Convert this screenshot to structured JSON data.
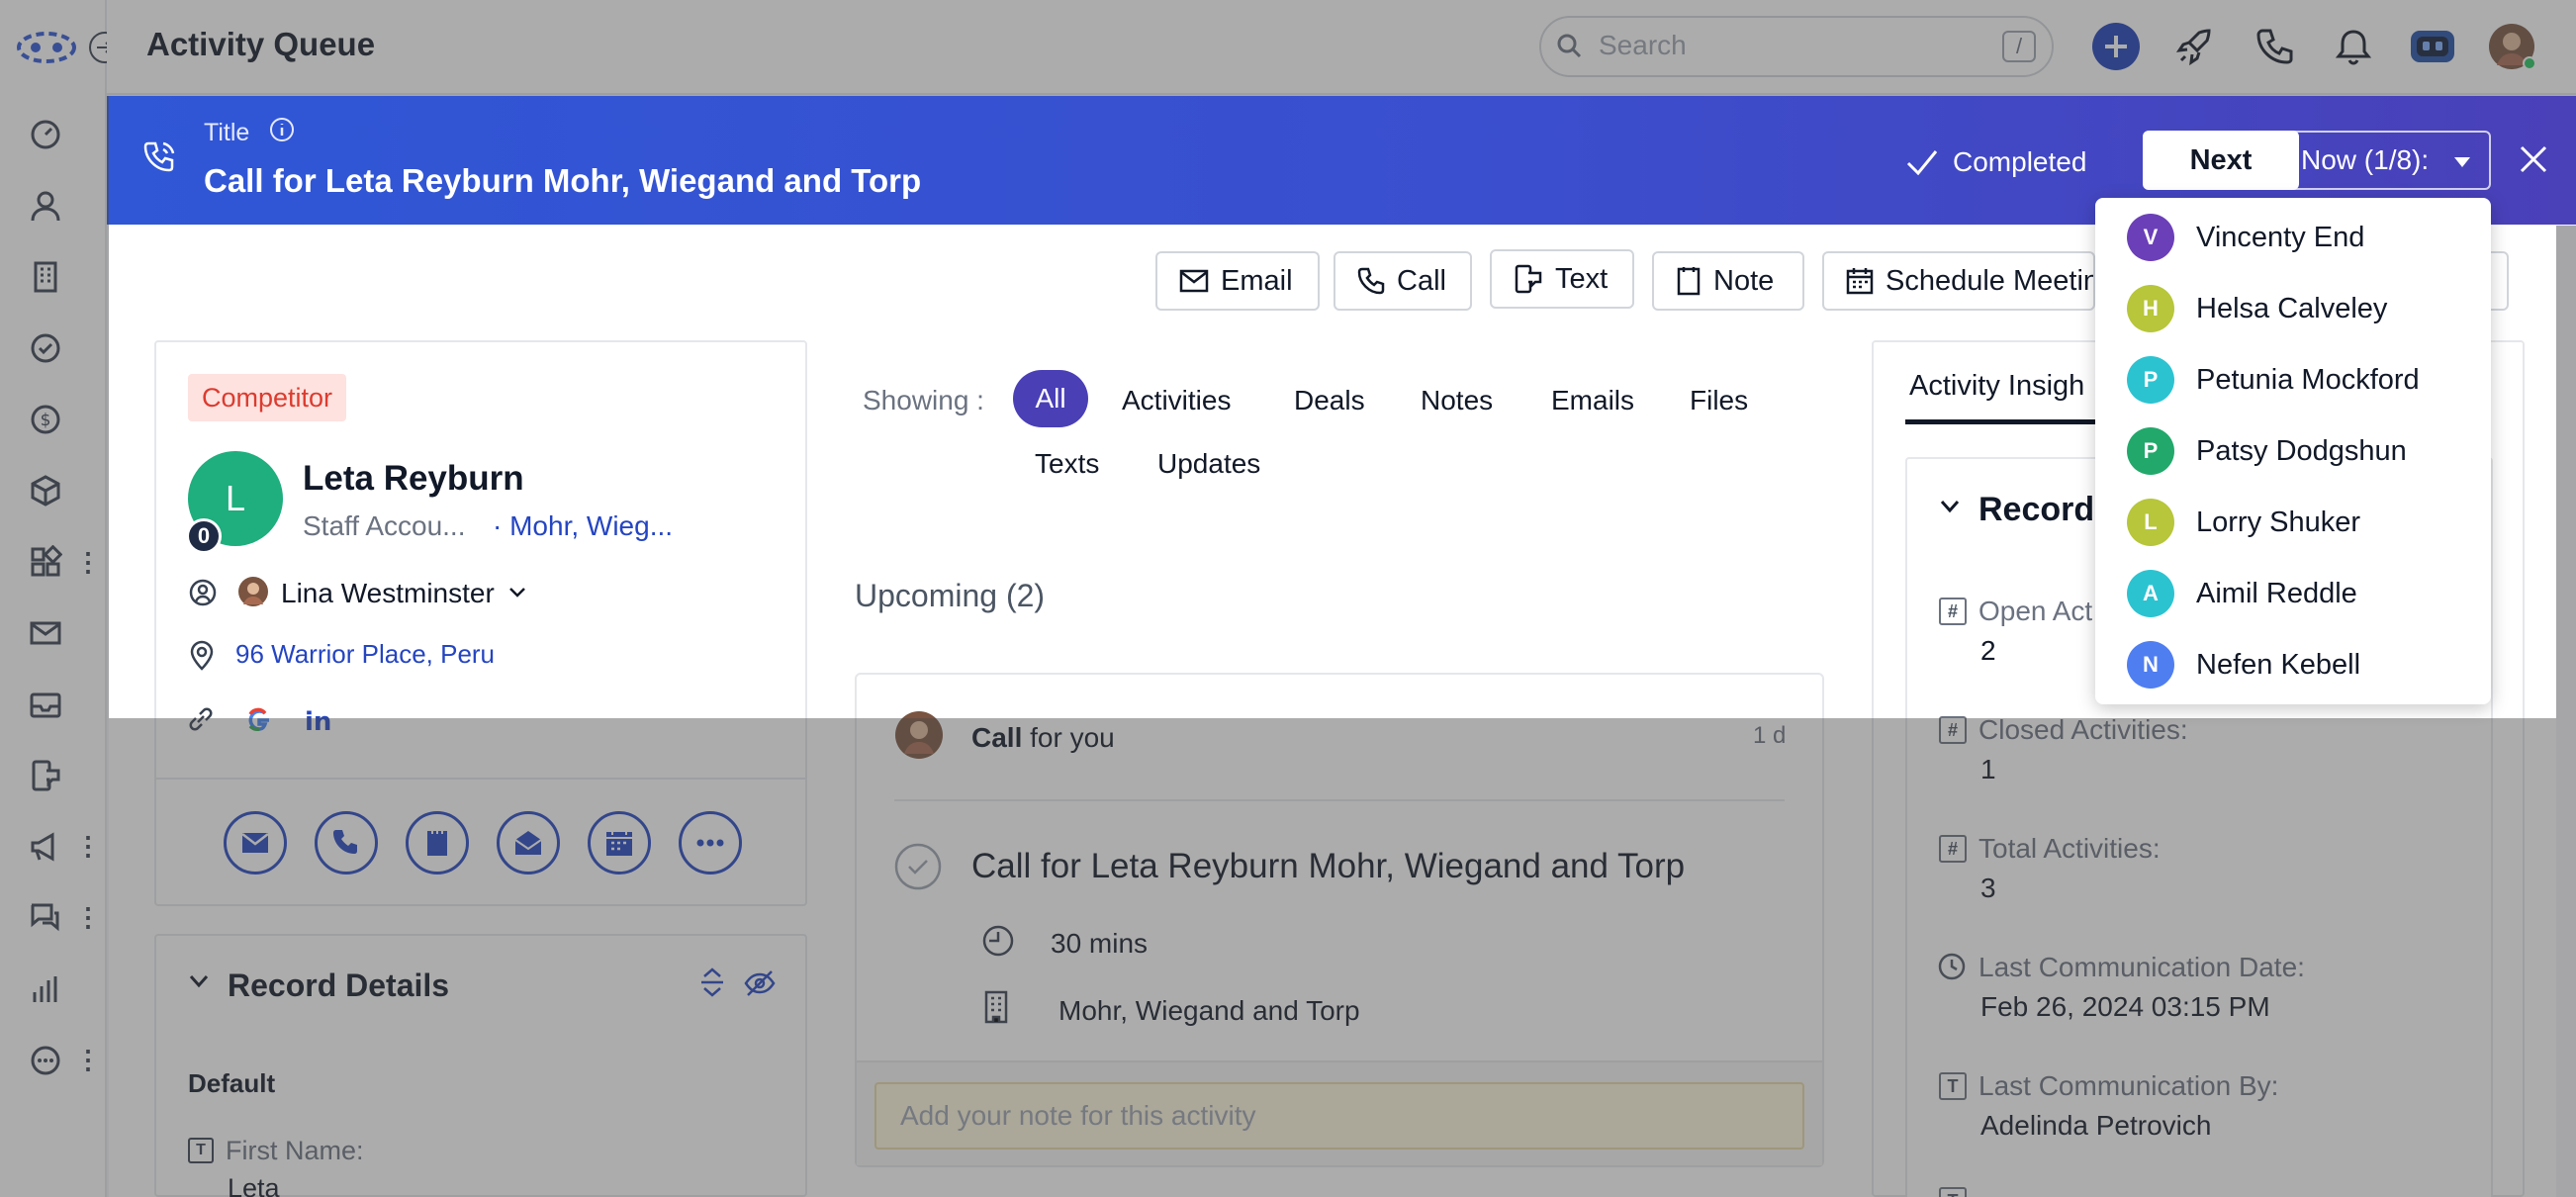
{
  "app": {
    "title": "Activity Queue"
  },
  "search": {
    "placeholder": "Search",
    "shortcut": "/"
  },
  "header": {
    "title_label": "Title",
    "title": "Call for Leta Reyburn Mohr, Wiegand and Torp",
    "completed_label": "Completed",
    "next_label": "Next",
    "now_label": "Now (1/8):"
  },
  "actions": {
    "email": "Email",
    "call": "Call",
    "text": "Text",
    "note": "Note",
    "schedule": "Schedule Meetin"
  },
  "contact": {
    "badge": "Competitor",
    "avatar_letter": "L",
    "avatar_count": "0",
    "name": "Leta Reyburn",
    "role": "Staff Accou...",
    "company": "· Mohr, Wieg...",
    "owner": "Lina Westminster",
    "address": "96 Warrior Place, Peru"
  },
  "record_details": {
    "title": "Record Details",
    "section": "Default",
    "first_name_label": "First Name:",
    "first_name_value": "Leta"
  },
  "filters": {
    "showing_label": "Showing :",
    "items": [
      "All",
      "Activities",
      "Deals",
      "Notes",
      "Emails",
      "Files",
      "Texts",
      "Updates"
    ]
  },
  "upcoming": {
    "label": "Upcoming (2)",
    "activity": {
      "type": "Call",
      "for": "for you",
      "time": "1 d",
      "title": "Call for Leta Reyburn Mohr, Wiegand and Torp",
      "duration": "30 mins",
      "company": "Mohr, Wiegand and Torp",
      "note_placeholder": "Add your note for this activity"
    }
  },
  "insights": {
    "tab_label": "Activity Insigh",
    "section_label": "Record",
    "open_label": "Open Act",
    "open_value": "2",
    "closed_label": "Closed Activities:",
    "closed_value": "1",
    "total_label": "Total Activities:",
    "total_value": "3",
    "last_comm_date_label": "Last Communication Date:",
    "last_comm_date_value": "Feb 26, 2024 03:15 PM",
    "last_comm_by_label": "Last Communication By:",
    "last_comm_by_value": "Adelinda Petrovich"
  },
  "queue": [
    {
      "initial": "V",
      "name": "Vincenty End",
      "color": "#6b3fb8"
    },
    {
      "initial": "H",
      "name": "Helsa Calveley",
      "color": "#b7c63a"
    },
    {
      "initial": "P",
      "name": "Petunia Mockford",
      "color": "#2cc3d1"
    },
    {
      "initial": "P",
      "name": "Patsy Dodgshun",
      "color": "#22a86b"
    },
    {
      "initial": "L",
      "name": "Lorry Shuker",
      "color": "#b7c63a"
    },
    {
      "initial": "A",
      "name": "Aimil Reddle",
      "color": "#2cc3d1"
    },
    {
      "initial": "N",
      "name": "Nefen Kebell",
      "color": "#4f7ef0"
    }
  ]
}
